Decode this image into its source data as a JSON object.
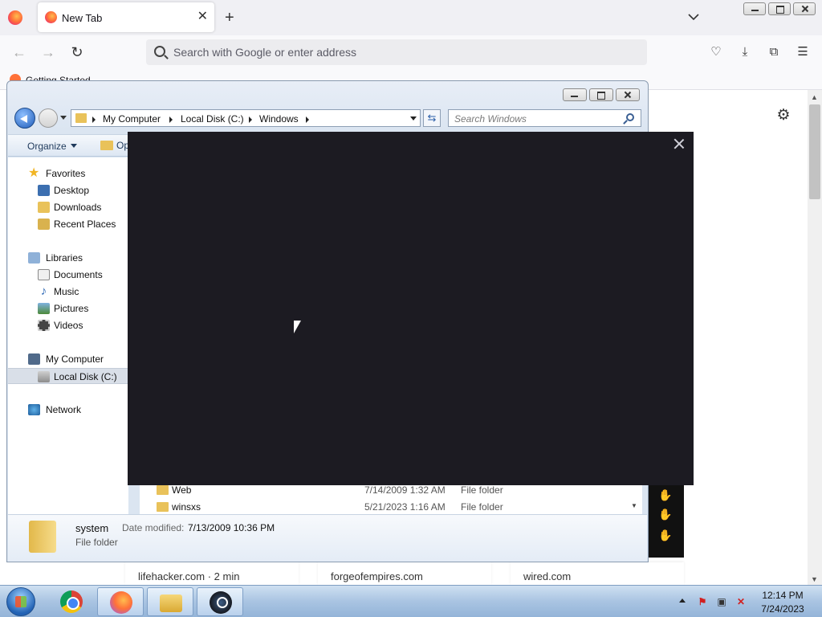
{
  "browser": {
    "tab_title": "New Tab",
    "new_tab_symbol": "+",
    "url_placeholder": "Search with Google or enter address",
    "bookmark": "Getting Started",
    "tiles": [
      "lifehacker.com · 2 min",
      "forgeofempires.com",
      "wired.com"
    ]
  },
  "explorer": {
    "breadcrumbs": [
      "My Computer",
      "Local Disk (C:)",
      "Windows"
    ],
    "search_placeholder": "Search Windows",
    "toolbar": {
      "organize": "Organize",
      "open": "Op"
    },
    "nav": {
      "favorites": "Favorites",
      "desktop": "Desktop",
      "downloads": "Downloads",
      "recent_places": "Recent Places",
      "libraries": "Libraries",
      "documents": "Documents",
      "music": "Music",
      "pictures": "Pictures",
      "videos": "Videos",
      "my_computer": "My Computer",
      "local_disk": "Local Disk (C:)",
      "network": "Network"
    },
    "files": [
      {
        "name": "Web",
        "date": "7/14/2009 1:32 AM",
        "type": "File folder"
      },
      {
        "name": "winsxs",
        "date": "5/21/2023 1:16 AM",
        "type": "File folder"
      }
    ],
    "details": {
      "name": "system",
      "type": "File folder",
      "date_label": "Date modified:",
      "date": "7/13/2009 10:36 PM"
    }
  },
  "taskbar": {
    "time": "12:14 PM",
    "date": "7/24/2023"
  }
}
